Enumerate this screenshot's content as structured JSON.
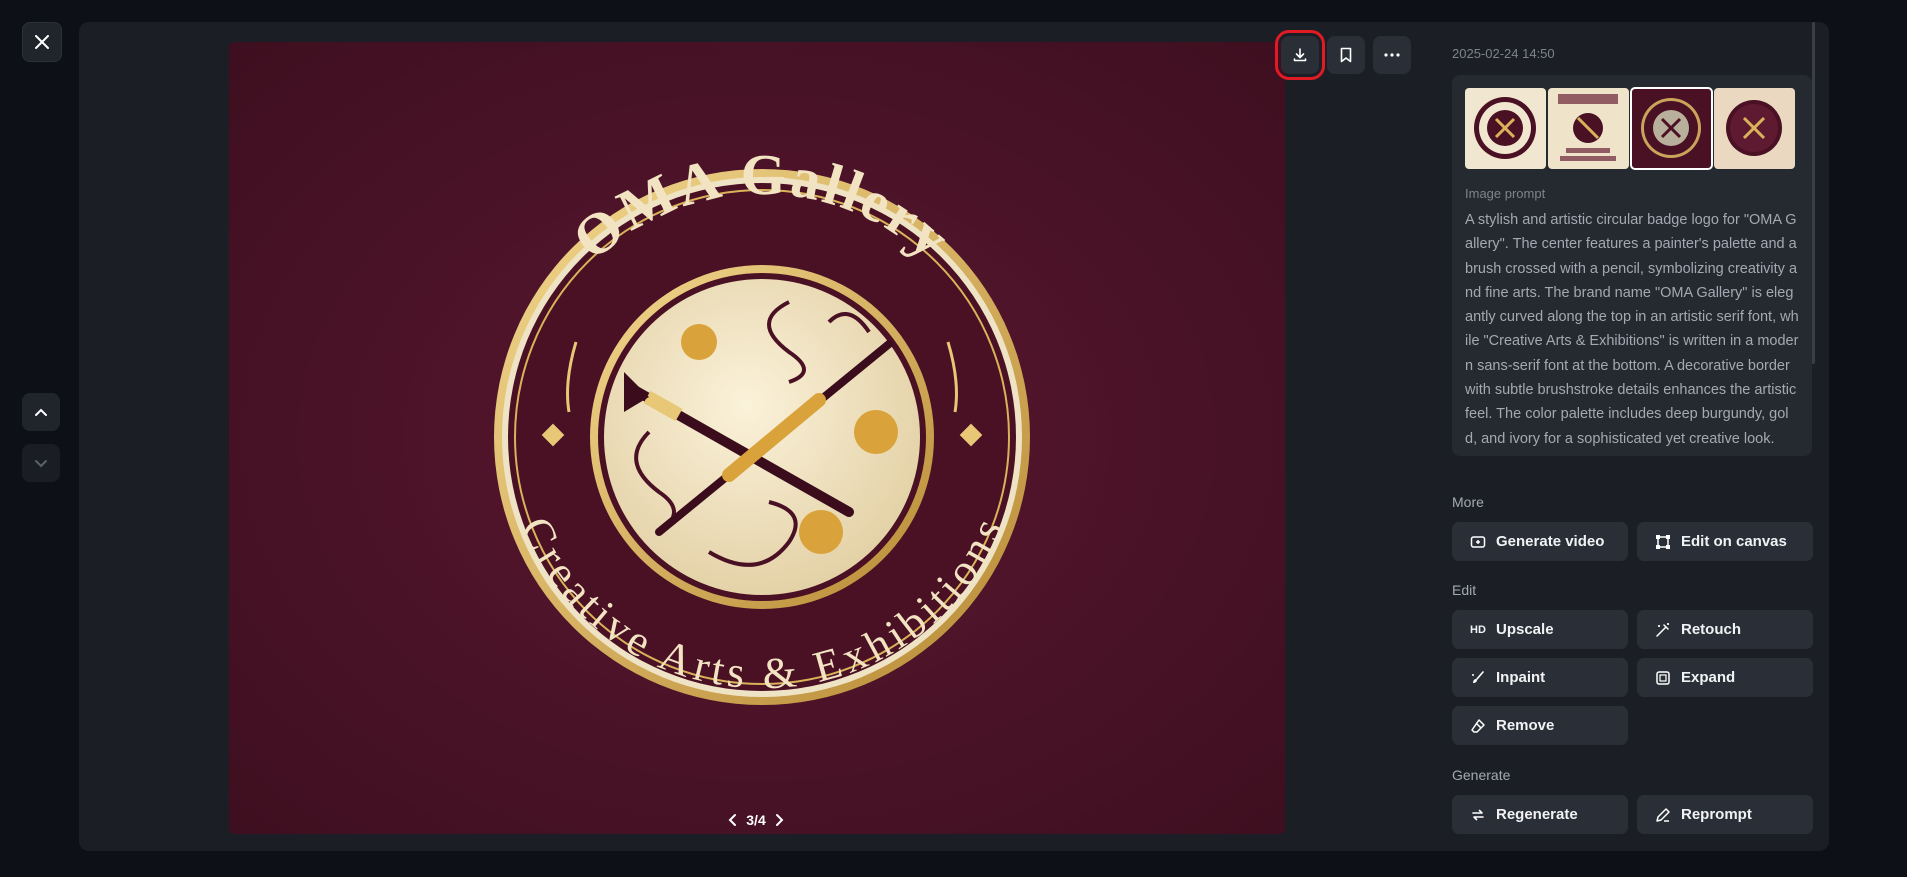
{
  "timestamp": "2025-02-24 14:50",
  "pager": {
    "text": "3/4",
    "current": 3,
    "total": 4
  },
  "artwork": {
    "title": "OMA Gallery",
    "subtitle": "Creative Arts & Exhibitions"
  },
  "prompt": {
    "label": "Image prompt",
    "text": "A stylish and artistic circular badge logo for \"OMA Gallery\". The center features a painter's palette and a brush crossed with a pencil, symbolizing creativity and fine arts. The brand name \"OMA Gallery\" is elegantly curved along the top in an artistic serif font, while \"Creative Arts & Exhibitions\" is written in a modern sans-serif font at the bottom. A decorative border with subtle brushstroke details enhances the artistic feel. The color palette includes deep burgundy, gold, and ivory for a sophisticated yet creative look."
  },
  "thumbnails": [
    {
      "name": "thumb-1",
      "selected": false
    },
    {
      "name": "thumb-2",
      "selected": false
    },
    {
      "name": "thumb-3",
      "selected": true
    },
    {
      "name": "thumb-4",
      "selected": false
    }
  ],
  "sections": {
    "more": {
      "label": "More",
      "buttons": [
        {
          "label": "Generate video",
          "icon": "video-add-icon"
        },
        {
          "label": "Edit on canvas",
          "icon": "canvas-icon"
        }
      ]
    },
    "edit": {
      "label": "Edit",
      "buttons": [
        {
          "label": "Upscale",
          "icon": "hd-icon",
          "icon_text": "HD"
        },
        {
          "label": "Retouch",
          "icon": "wand-icon"
        },
        {
          "label": "Inpaint",
          "icon": "brush-icon"
        },
        {
          "label": "Expand",
          "icon": "expand-icon"
        },
        {
          "label": "Remove",
          "icon": "eraser-icon"
        }
      ]
    },
    "generate": {
      "label": "Generate",
      "buttons": [
        {
          "label": "Regenerate",
          "icon": "refresh-icon"
        },
        {
          "label": "Reprompt",
          "icon": "pencil-icon"
        }
      ]
    }
  },
  "colors": {
    "highlight": "#e01b24",
    "burgundy": "#4d1428",
    "gold": "#d9b35a",
    "ivory": "#efe3c6"
  }
}
